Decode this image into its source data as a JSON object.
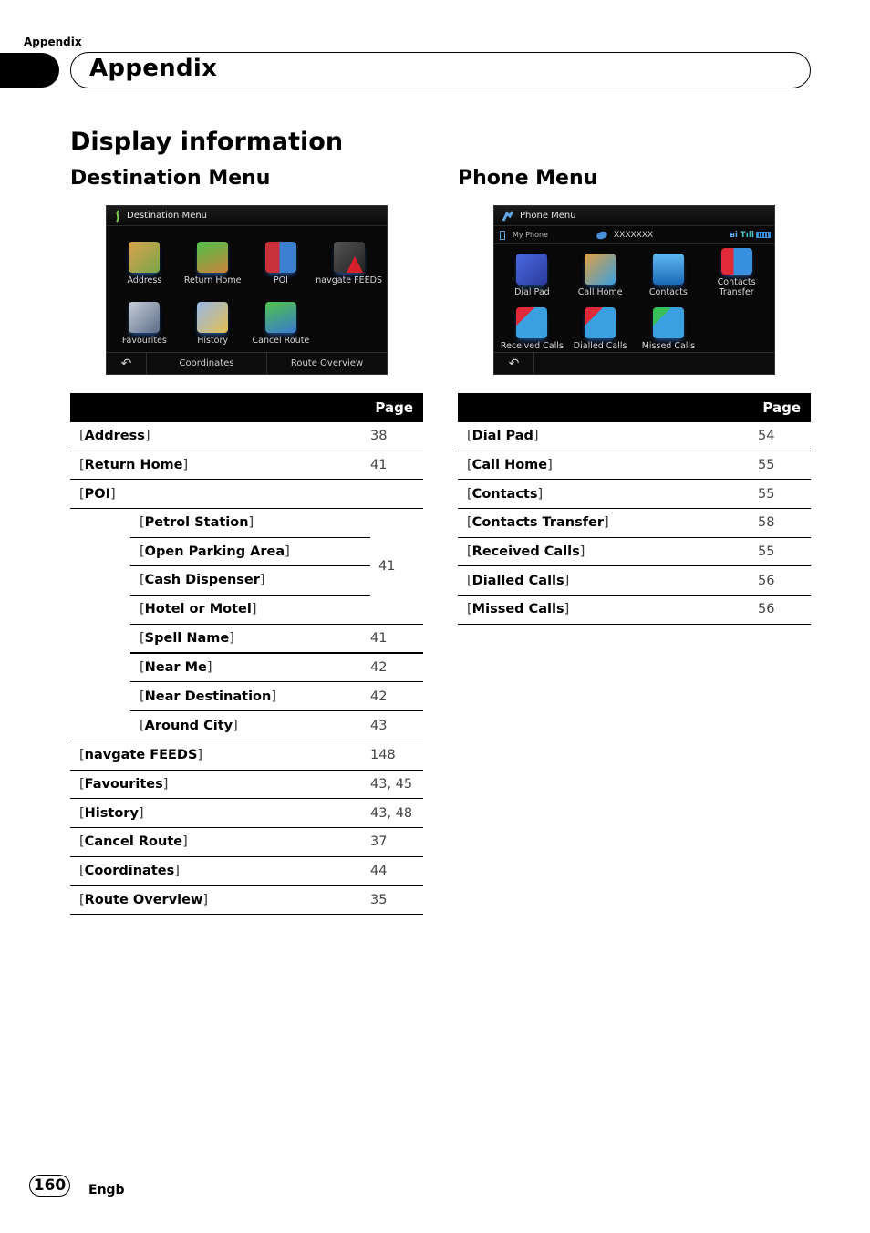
{
  "running_head": "Appendix",
  "chapter_title": "Appendix",
  "section_title": "Display information",
  "destination": {
    "heading": "Destination Menu",
    "screen": {
      "title": "Destination Menu",
      "tiles": [
        {
          "label": "Address",
          "icon": "address-map-icon"
        },
        {
          "label": "Return Home",
          "icon": "return-home-icon"
        },
        {
          "label": "POI",
          "icon": "poi-icon"
        },
        {
          "label": "navgate FEEDS",
          "icon": "navgate-feeds-icon"
        },
        {
          "label": "Favourites",
          "icon": "favourites-icon"
        },
        {
          "label": "History",
          "icon": "history-icon"
        },
        {
          "label": "Cancel Route",
          "icon": "cancel-route-icon"
        }
      ],
      "back_glyph": "↶",
      "bottom_buttons": [
        "Coordinates",
        "Route Overview"
      ]
    },
    "table": {
      "header_page": "Page",
      "rows": [
        {
          "label": "Address",
          "page": "38"
        },
        {
          "label": "Return Home",
          "page": "41"
        },
        {
          "label": "POI",
          "page": ""
        }
      ],
      "poi_group": {
        "labels": [
          "Petrol Station",
          "Open Parking Area",
          "Cash Dispenser",
          "Hotel or Motel"
        ],
        "page": "41"
      },
      "poi_subrows": [
        {
          "label": "Spell Name",
          "page": "41"
        },
        {
          "label": "Near Me",
          "page": "42"
        },
        {
          "label": "Near Destination",
          "page": "42"
        },
        {
          "label": "Around City",
          "page": "43"
        }
      ],
      "rows_after": [
        {
          "label": "navgate FEEDS",
          "page": "148"
        },
        {
          "label": "Favourites",
          "page": "43, 45"
        },
        {
          "label": "History",
          "page": "43, 48"
        },
        {
          "label": "Cancel Route",
          "page": "37"
        },
        {
          "label": "Coordinates",
          "page": "44"
        },
        {
          "label": "Route Overview",
          "page": "35"
        }
      ]
    }
  },
  "phone": {
    "heading": "Phone Menu",
    "screen": {
      "title": "Phone Menu",
      "status": {
        "device": "My Phone",
        "name": "XXXXXXX"
      },
      "tiles": [
        {
          "label": "Dial Pad",
          "icon": "dial-pad-icon"
        },
        {
          "label": "Call Home",
          "icon": "call-home-icon"
        },
        {
          "label": "Contacts",
          "icon": "contacts-icon"
        },
        {
          "label": "Contacts Transfer",
          "icon": "contacts-transfer-icon"
        },
        {
          "label": "Received Calls",
          "icon": "received-calls-icon"
        },
        {
          "label": "Dialled Calls",
          "icon": "dialled-calls-icon"
        },
        {
          "label": "Missed Calls",
          "icon": "missed-calls-icon"
        }
      ],
      "back_glyph": "↶"
    },
    "table": {
      "header_page": "Page",
      "rows": [
        {
          "label": "Dial Pad",
          "page": "54"
        },
        {
          "label": "Call Home",
          "page": "55"
        },
        {
          "label": "Contacts",
          "page": "55"
        },
        {
          "label": "Contacts Transfer",
          "page": "58"
        },
        {
          "label": "Received Calls",
          "page": "55"
        },
        {
          "label": "Dialled Calls",
          "page": "56"
        },
        {
          "label": "Missed Calls",
          "page": "56"
        }
      ]
    }
  },
  "footer": {
    "page_number": "160",
    "language": "Engb"
  }
}
